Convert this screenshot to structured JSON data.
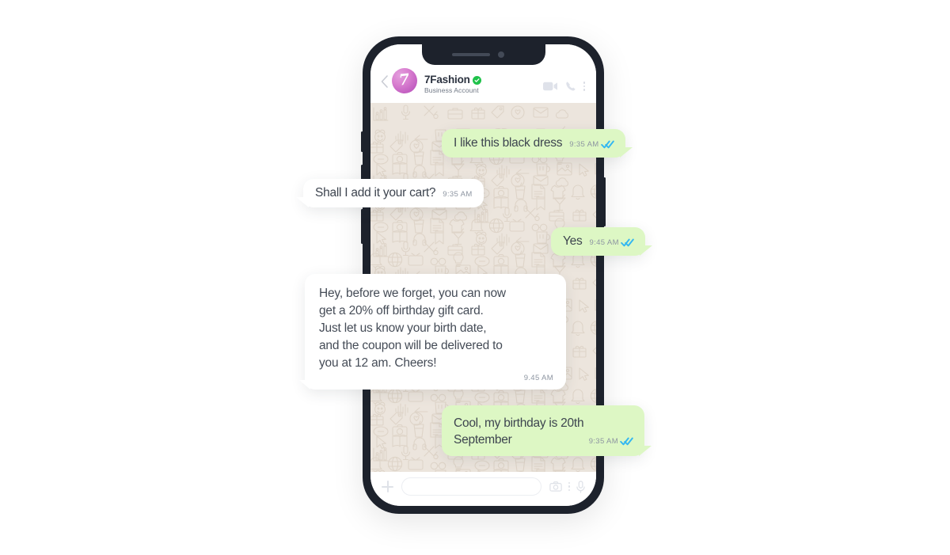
{
  "app": {
    "name": "WhatsApp Business Chat Mockup",
    "accent_green_bubble": "#ddf7c4",
    "accent_white_bubble": "#ffffff",
    "chat_background": "#ece5dd",
    "phone_frame": "#1d222c",
    "verified_badge_color": "#1fc24a",
    "tick_color": "#34b7f1"
  },
  "header": {
    "back_icon": "chevron-left-icon",
    "avatar_glyph": "7",
    "avatar_name": "7fashion-avatar",
    "name": "7Fashion",
    "verified": true,
    "verified_icon": "verified-check-icon",
    "subtitle": "Business Account",
    "icons": [
      {
        "name": "video-call-icon",
        "label": "Video call"
      },
      {
        "name": "voice-call-icon",
        "label": "Voice call"
      },
      {
        "name": "overflow-menu-icon",
        "label": "More options"
      }
    ]
  },
  "messages": [
    {
      "id": "bubble-1",
      "direction": "outgoing",
      "text": "I like this black dress",
      "time": "9:35 AM",
      "status": "read",
      "status_icon": "double-check-icon"
    },
    {
      "id": "bubble-2",
      "direction": "incoming",
      "text": "Shall I add it your cart?",
      "time": "9:35 AM",
      "status": "none"
    },
    {
      "id": "bubble-3",
      "direction": "outgoing",
      "text": "Yes",
      "time": "9:45 AM",
      "status": "read",
      "status_icon": "double-check-icon"
    },
    {
      "id": "bubble-4",
      "direction": "incoming",
      "text": "Hey, before we forget, you can now\nget a 20% off birthday gift card.\nJust let us know your birth date,\nand the coupon will be delivered to\nyou at 12 am. Cheers!",
      "time": "9.45 AM",
      "status": "none"
    },
    {
      "id": "bubble-5",
      "direction": "outgoing",
      "text_line_1": "Cool, my birthday is 20th",
      "text_line_2": "September",
      "time": "9:35 AM",
      "status": "read",
      "status_icon": "double-check-icon"
    }
  ],
  "composer": {
    "add_icon": "plus-icon",
    "input_value": "",
    "input_placeholder": "",
    "icons": [
      {
        "name": "camera-icon",
        "label": "Camera"
      },
      {
        "name": "overflow-menu-icon",
        "label": "More"
      },
      {
        "name": "microphone-icon",
        "label": "Voice message"
      }
    ]
  },
  "device": {
    "notch_speaker": "earpiece-speaker",
    "notch_camera": "front-camera"
  }
}
